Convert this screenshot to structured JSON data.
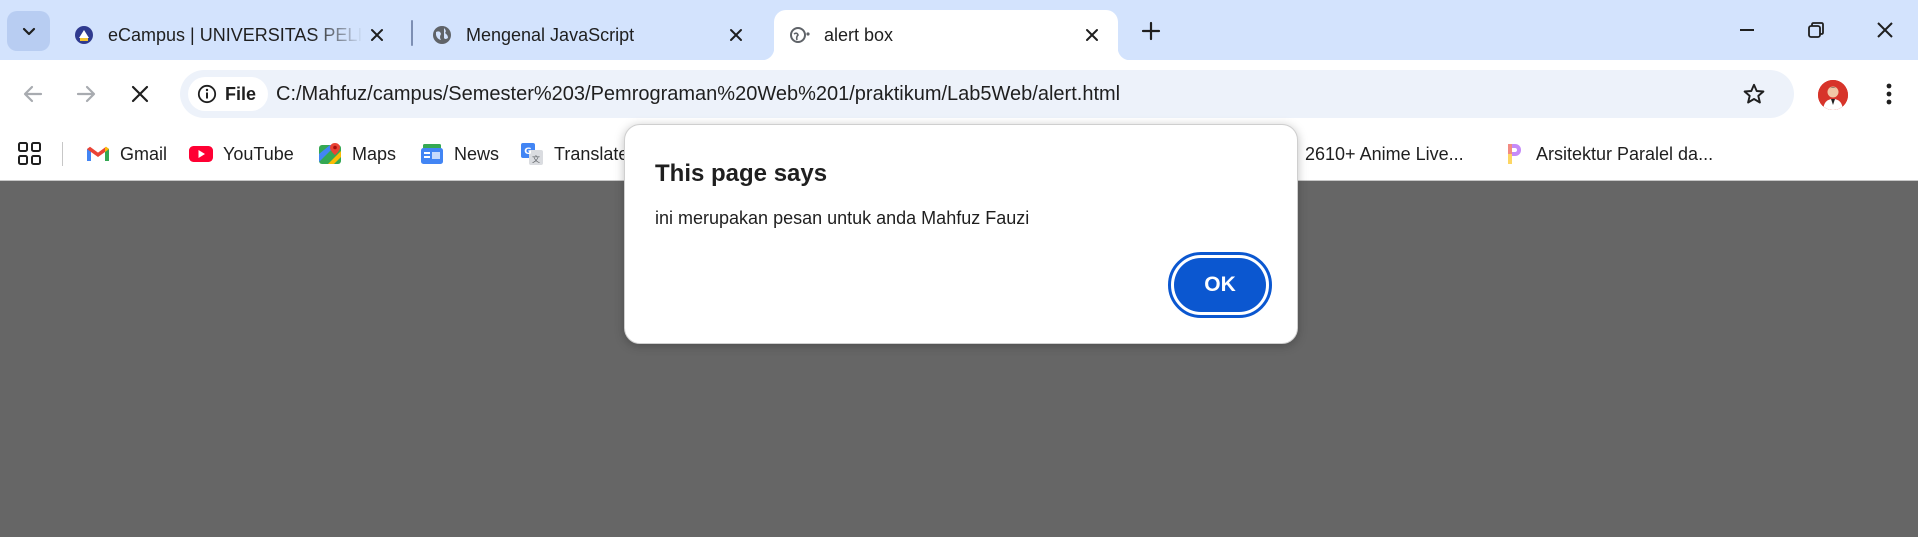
{
  "tabs": [
    {
      "title": "eCampus | UNIVERSITAS PELITA BANGSA",
      "favicon": "university-logo-icon"
    },
    {
      "title": "Mengenal JavaScript",
      "favicon": "globe-icon"
    },
    {
      "title": "alert box",
      "favicon": "loading-globe-icon",
      "active": true
    }
  ],
  "toolbar": {
    "chip_label": "File",
    "url": "C:/Mahfuz/campus/Semester%203/Pemrograman%20Web%201/praktikum/Lab5Web/alert.html"
  },
  "bookmarks": [
    {
      "label": "Gmail",
      "icon": "gmail-icon"
    },
    {
      "label": "YouTube",
      "icon": "youtube-icon"
    },
    {
      "label": "Maps",
      "icon": "maps-icon"
    },
    {
      "label": "News",
      "icon": "news-icon"
    },
    {
      "label": "Translate",
      "icon": "translate-icon"
    },
    {
      "label": "2610+ Anime Live...",
      "icon": "bookmark-icon"
    },
    {
      "label": "Arsitektur Paralel da...",
      "icon": "bookmark-icon"
    }
  ],
  "dialog": {
    "title": "This page says",
    "message": "ini merupakan pesan untuk anda Mahfuz Fauzi",
    "ok_label": "OK"
  },
  "colors": {
    "tabstrip": "#d3e3fd",
    "omnibox": "#edf2fa",
    "accent": "#0b57d0",
    "page_dim": "#666666"
  }
}
